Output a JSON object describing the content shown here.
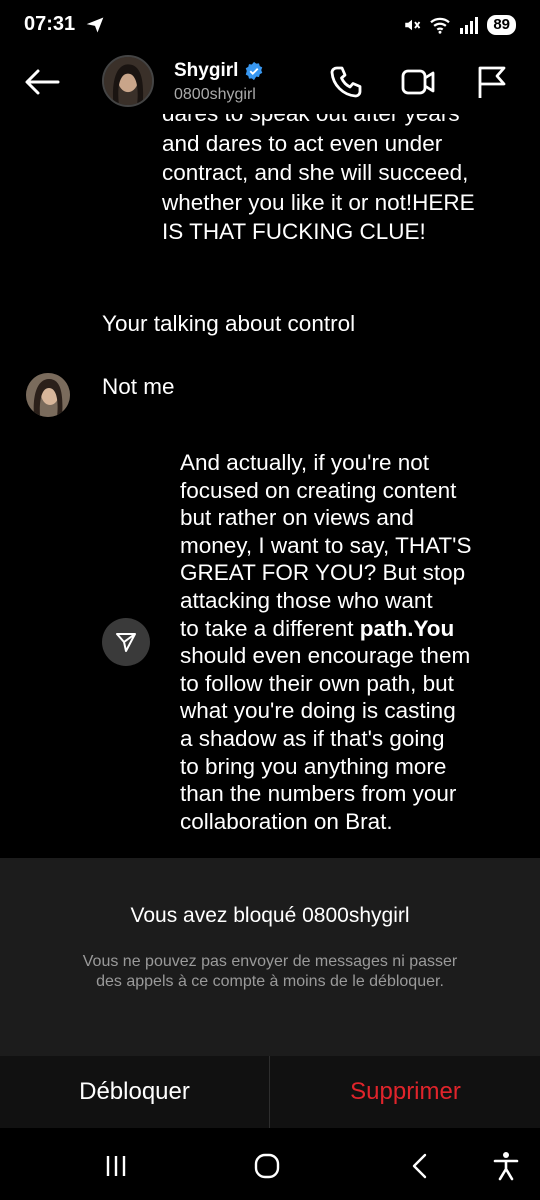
{
  "status_bar": {
    "time": "07:31",
    "battery": "89"
  },
  "header": {
    "name": "Shygirl",
    "handle": "0800shygirl"
  },
  "messages": {
    "m1_lines": [
      "dares to speak out after years",
      "and dares to act even under",
      "contract, and she will succeed,",
      "whether you like it or not!HERE",
      "IS THAT FUCKING CLUE!"
    ],
    "m2": "Your talking about control",
    "m3": "Not me",
    "m4_lines": [
      "And actually, if you're not",
      "focused on creating content",
      "but rather on views and",
      "money, I want to say, THAT'S",
      "GREAT FOR YOU? But stop",
      "attacking those who want"
    ],
    "m4_line7_pre": "to take a different ",
    "m4_line7_bold": "path.You",
    "m4_rest_lines": [
      "should even encourage them",
      "to follow their own path, but",
      "what you're doing is casting",
      "a shadow as if that's going",
      "to bring you anything more",
      "than the numbers from your",
      "collaboration on Brat."
    ]
  },
  "blocked": {
    "title": "Vous avez bloqué 0800shygirl",
    "description": "Vous ne pouvez pas envoyer de messages ni passer des appels à ce compte à moins de le débloquer."
  },
  "actions": {
    "unblock": "Débloquer",
    "delete": "Supprimer"
  },
  "colors": {
    "background": "#000000",
    "verified": "#3897f0",
    "delete": "#e0242b",
    "panel": "#1c1c1c"
  },
  "icons": [
    "send-icon",
    "mute-icon",
    "wifi-icon",
    "signal-icon",
    "back-arrow-icon",
    "verified-badge-icon",
    "phone-icon",
    "video-camera-icon",
    "flag-icon",
    "reply-arrow-icon",
    "recents-icon",
    "home-icon",
    "nav-back-icon",
    "accessibility-icon"
  ]
}
